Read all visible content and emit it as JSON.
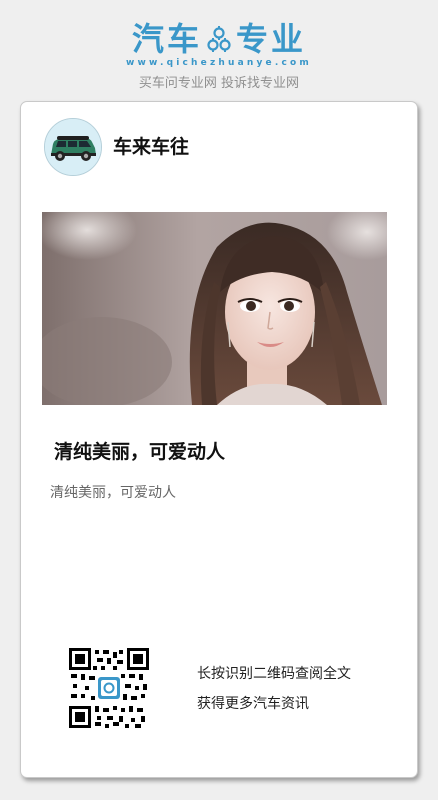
{
  "header": {
    "logo_left": "汽车",
    "logo_right": "专业",
    "logo_url": "www.qichezhuanye.com",
    "slogan": "买车问专业网 投诉找专业网",
    "brand_color": "#3a97c9"
  },
  "card": {
    "author": "车来车往",
    "avatar_icon": "green-minivan-icon",
    "title": "清纯美丽，可爱动人",
    "summary": "清纯美丽，可爱动人",
    "qr": {
      "hint_line1": "长按识别二维码查阅全文",
      "hint_line2": "获得更多汽车资讯"
    }
  }
}
